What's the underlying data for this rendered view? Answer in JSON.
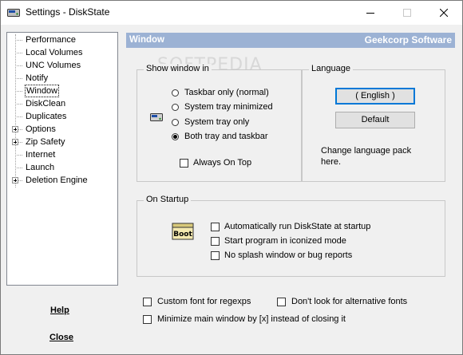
{
  "titlebar": {
    "title": "Settings - DiskState",
    "app_icon": "disk-icon"
  },
  "tree": {
    "items": [
      {
        "label": "Performance",
        "expandable": false
      },
      {
        "label": "Local Volumes",
        "expandable": false
      },
      {
        "label": "UNC Volumes",
        "expandable": false
      },
      {
        "label": "Notify",
        "expandable": false
      },
      {
        "label": "Window",
        "expandable": false,
        "selected": true
      },
      {
        "label": "DiskClean",
        "expandable": false
      },
      {
        "label": "Duplicates",
        "expandable": false
      },
      {
        "label": "Options",
        "expandable": true
      },
      {
        "label": "Zip Safety",
        "expandable": true
      },
      {
        "label": "Internet",
        "expandable": false
      },
      {
        "label": "Launch",
        "expandable": false
      },
      {
        "label": "Deletion Engine",
        "expandable": true
      }
    ]
  },
  "links": {
    "help": "Help",
    "close": "Close"
  },
  "header": {
    "left": "Window",
    "right": "Geekcorp Software"
  },
  "watermark": "SOFTPEDIA",
  "show_window": {
    "title": "Show window in",
    "options": [
      {
        "label": "Taskbar only (normal)",
        "checked": false
      },
      {
        "label": "System tray minimized",
        "checked": false
      },
      {
        "label": "System tray only",
        "checked": false
      },
      {
        "label": "Both tray and taskbar",
        "checked": true
      }
    ],
    "always_on_top": {
      "label": "Always On Top",
      "checked": false
    }
  },
  "language": {
    "title": "Language",
    "language_button": "( English )",
    "default_button": "Default",
    "note": "Change language pack here."
  },
  "startup": {
    "title": "On Startup",
    "boot_icon_text": "Boot",
    "options": [
      {
        "label": "Automatically run DiskState at startup",
        "checked": false
      },
      {
        "label": "Start program in iconized mode",
        "checked": false
      },
      {
        "label": "No splash window or bug reports",
        "checked": false
      }
    ]
  },
  "bottom_options": {
    "custom_font": {
      "label": "Custom font for regexps",
      "checked": false
    },
    "no_alt_fonts": {
      "label": "Don't look for alternative fonts",
      "checked": false
    },
    "minimize_by_x": {
      "label": "Minimize main window by [x] instead of closing it",
      "checked": false
    }
  }
}
